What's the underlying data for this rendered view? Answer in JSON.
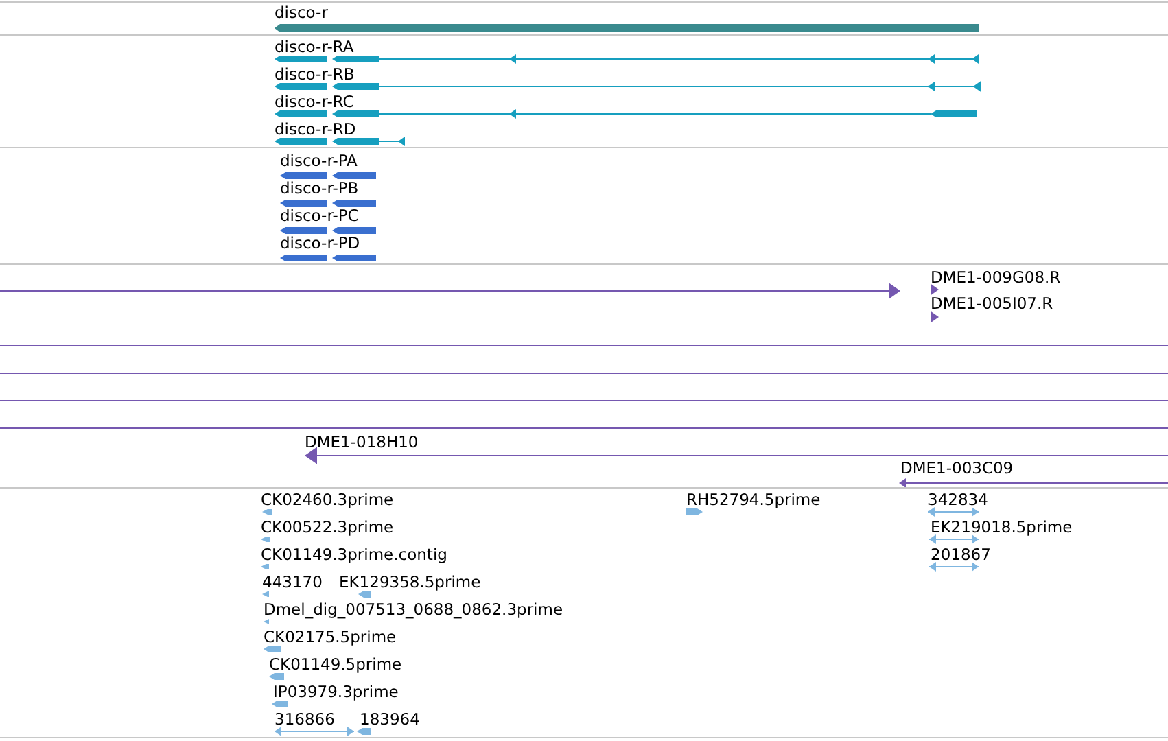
{
  "tracks": [
    {
      "kind": "gene",
      "features": [
        {
          "label": "disco-r"
        }
      ]
    },
    {
      "kind": "transcript",
      "features": [
        {
          "label": "disco-r-RA"
        },
        {
          "label": "disco-r-RB"
        },
        {
          "label": "disco-r-RC"
        },
        {
          "label": "disco-r-RD"
        }
      ]
    },
    {
      "kind": "protein",
      "features": [
        {
          "label": "disco-r-PA"
        },
        {
          "label": "disco-r-PB"
        },
        {
          "label": "disco-r-PC"
        },
        {
          "label": "disco-r-PD"
        }
      ]
    },
    {
      "kind": "clone",
      "features": [
        {
          "label": "DME1-009G08.R"
        },
        {
          "label": "DME1-005I07.R"
        },
        {
          "label": "DME1-018H10"
        },
        {
          "label": "DME1-003C09"
        }
      ]
    },
    {
      "kind": "est",
      "features": [
        {
          "label": "CK02460.3prime"
        },
        {
          "label": "RH52794.5prime"
        },
        {
          "label": "342834"
        },
        {
          "label": "CK00522.3prime"
        },
        {
          "label": "EK219018.5prime"
        },
        {
          "label": "CK01149.3prime.contig"
        },
        {
          "label": "201867"
        },
        {
          "label": "443170"
        },
        {
          "label": "EK129358.5prime"
        },
        {
          "label": "Dmel_dig_007513_0688_0862.3prime"
        },
        {
          "label": "CK02175.5prime"
        },
        {
          "label": "CK01149.5prime"
        },
        {
          "label": "IP03979.3prime"
        },
        {
          "label": "316866"
        },
        {
          "label": "183964"
        }
      ]
    }
  ]
}
